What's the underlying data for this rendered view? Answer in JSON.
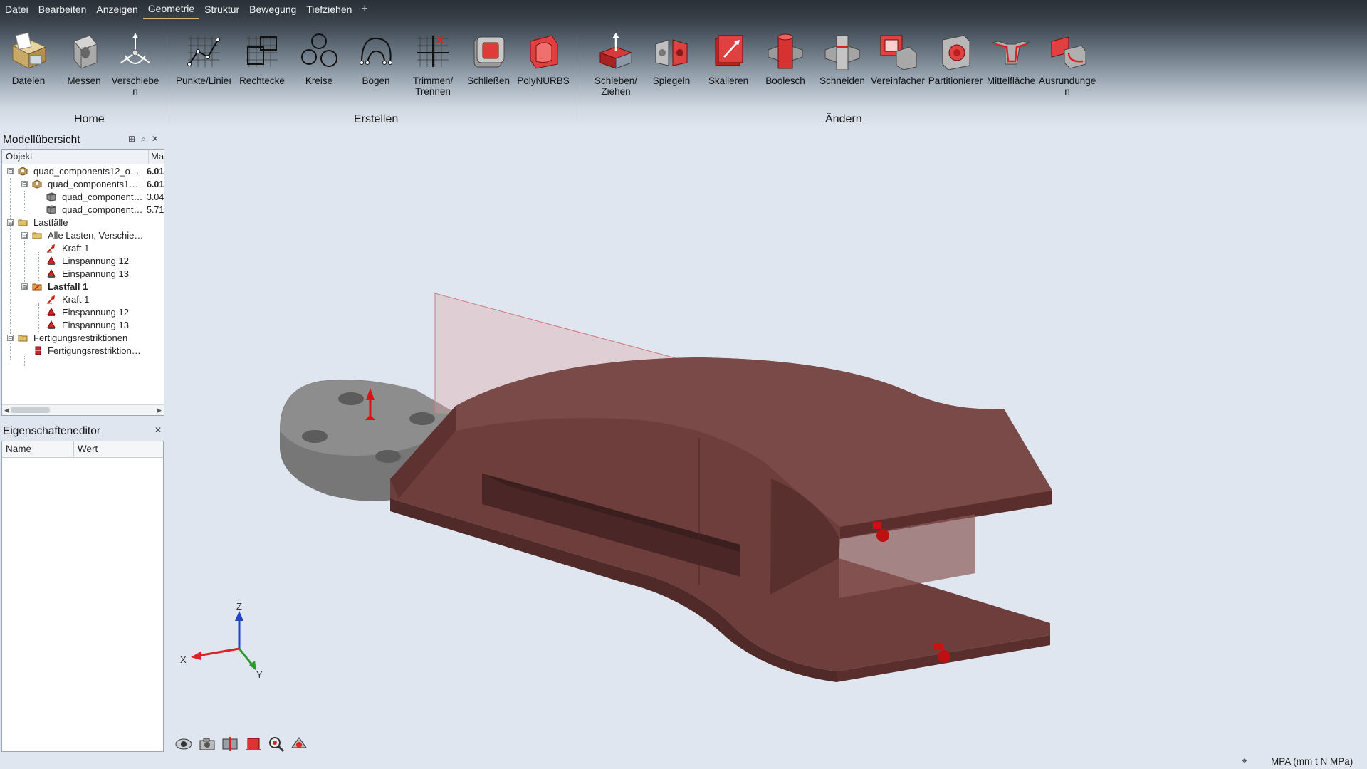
{
  "menu": {
    "items": [
      "Datei",
      "Bearbeiten",
      "Anzeigen",
      "Geometrie",
      "Struktur",
      "Bewegung",
      "Tiefziehen"
    ],
    "active": "Geometrie",
    "add_symbol": "+"
  },
  "ribbon": {
    "tools": [
      {
        "label": "Dateien",
        "icon": "folder-files-icon"
      },
      {
        "label": "Messen",
        "icon": "measure-icon"
      },
      {
        "label": "Verschiebe\nn",
        "icon": "move-axes-icon"
      },
      {
        "label": "Punkte/Linieı",
        "icon": "points-lines-icon"
      },
      {
        "label": "Rechtecke",
        "icon": "rectangles-icon"
      },
      {
        "label": "Kreise",
        "icon": "circles-icon"
      },
      {
        "label": "Bögen",
        "icon": "arcs-icon"
      },
      {
        "label": "Trimmen/\nTrennen",
        "icon": "trim-split-icon"
      },
      {
        "label": "Schließen",
        "icon": "close-shape-icon"
      },
      {
        "label": "PolyNURBS",
        "icon": "polynurbs-icon"
      },
      {
        "label": "Schieben/\nZiehen",
        "icon": "push-pull-icon"
      },
      {
        "label": "Spiegeln",
        "icon": "mirror-icon"
      },
      {
        "label": "Skalieren",
        "icon": "scale-icon"
      },
      {
        "label": "Boolesch",
        "icon": "boolean-icon"
      },
      {
        "label": "Schneiden",
        "icon": "cut-icon"
      },
      {
        "label": "Vereinfacher",
        "icon": "simplify-icon"
      },
      {
        "label": "Partitionierer",
        "icon": "partition-icon"
      },
      {
        "label": "Mittelfläche",
        "icon": "midsurface-icon"
      },
      {
        "label": "Ausrundunge\nn",
        "icon": "fillet-icon"
      }
    ],
    "groups": {
      "home": "Home",
      "create": "Erstellen",
      "modify": "Ändern"
    }
  },
  "model_browser": {
    "title": "Modellübersicht",
    "col_object": "Objekt",
    "col_mass": "Mas",
    "rows": [
      {
        "label": "quad_components12_o…",
        "value": "6.01",
        "bold_value": true,
        "icon": "assembly-icon",
        "toggle": "⊟"
      },
      {
        "label": "quad_components1…",
        "value": "6.01",
        "bold_value": true,
        "icon": "assembly-icon",
        "toggle": "⊟"
      },
      {
        "label": "quad_component…",
        "value": "3.04",
        "icon": "part-icon"
      },
      {
        "label": "quad_component…",
        "value": "5.71",
        "icon": "part-icon"
      },
      {
        "label": "Lastfälle",
        "icon": "folder-icon",
        "toggle": "⊟"
      },
      {
        "label": "Alle Lasten, Verschie…",
        "icon": "folder-icon",
        "toggle": "⊟"
      },
      {
        "label": "Kraft 1",
        "icon": "force-icon"
      },
      {
        "label": "Einspannung 12",
        "icon": "constraint-icon"
      },
      {
        "label": "Einspannung 13",
        "icon": "constraint-icon"
      },
      {
        "label": "Lastfall 1",
        "icon": "loadcase-icon",
        "toggle": "⊟",
        "bold": true
      },
      {
        "label": "Kraft 1",
        "icon": "force-icon"
      },
      {
        "label": "Einspannung 12",
        "icon": "constraint-icon"
      },
      {
        "label": "Einspannung 13",
        "icon": "constraint-icon"
      },
      {
        "label": "Fertigungsrestriktionen",
        "icon": "folder-icon",
        "toggle": "⊟"
      },
      {
        "label": "Fertigungsrestriktion…",
        "icon": "shape-control-icon"
      }
    ]
  },
  "property_editor": {
    "title": "Eigenschafteneditor",
    "col_name": "Name",
    "col_value": "Wert"
  },
  "axis_triad": {
    "z": "Z",
    "x": "X",
    "y": "Y"
  },
  "viewport_tools": [
    "view-eye-icon",
    "camera-icon",
    "section-cut-icon",
    "surface-icon",
    "zoom-icon",
    "render-icon"
  ],
  "status": {
    "units": "MPA (mm t N MPa)"
  },
  "colors": {
    "part_red": "#7a4a4a",
    "part_gray": "#8d8d8d",
    "force": "#d11",
    "highlight_plane": "#e0a3a6"
  }
}
